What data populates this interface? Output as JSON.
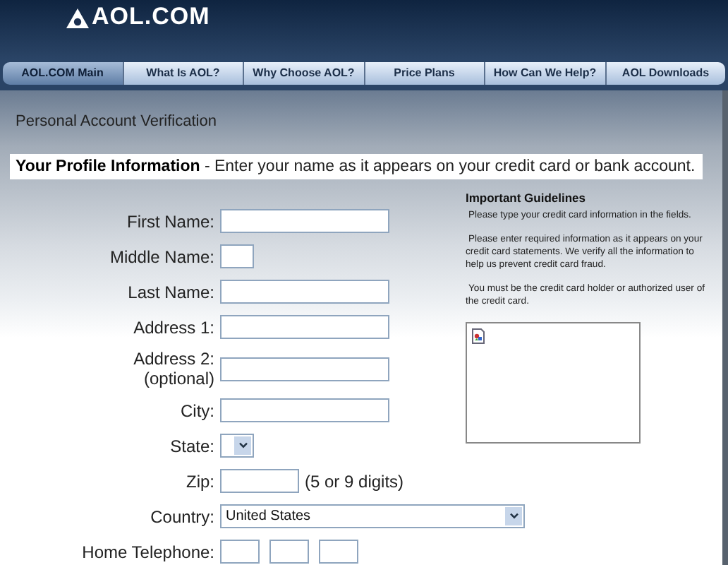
{
  "header": {
    "logo": "AOL.COM"
  },
  "nav": [
    {
      "label": "AOL.COM Main",
      "selected": true
    },
    {
      "label": "What Is AOL?",
      "selected": false
    },
    {
      "label": "Why Choose AOL?",
      "selected": false
    },
    {
      "label": "Price Plans",
      "selected": false
    },
    {
      "label": "How Can We Help?",
      "selected": false
    },
    {
      "label": "AOL Downloads",
      "selected": false
    }
  ],
  "page_title": "Personal Account Verification",
  "section": {
    "title": "Your Profile Information",
    "text": " - Enter your name as it appears on your credit card or bank account."
  },
  "fields": [
    {
      "label": "First Name:",
      "kind": "text"
    },
    {
      "label": "Middle Name:",
      "kind": "initial"
    },
    {
      "label": "Last Name:",
      "kind": "text"
    },
    {
      "label": "Address 1:",
      "kind": "text"
    },
    {
      "label": "Address 2:",
      "sublabel": "(optional)",
      "kind": "text"
    },
    {
      "label": "City:",
      "kind": "text"
    },
    {
      "label": "State:",
      "kind": "state"
    },
    {
      "label": "Zip:",
      "kind": "zip",
      "note": "(5 or 9 digits)"
    },
    {
      "label": "Country:",
      "kind": "country",
      "value": "United States"
    },
    {
      "label": "Home Telephone:",
      "kind": "phone"
    }
  ],
  "guidelines": {
    "title": "Important Guidelines",
    "paragraphs": [
      "Please type your credit card information in the fields.",
      "Please enter required information as it appears on your credit card statements. We verify all the information to help us prevent credit card fraud.",
      "You must be the credit card holder or authorized user of the credit card."
    ]
  }
}
